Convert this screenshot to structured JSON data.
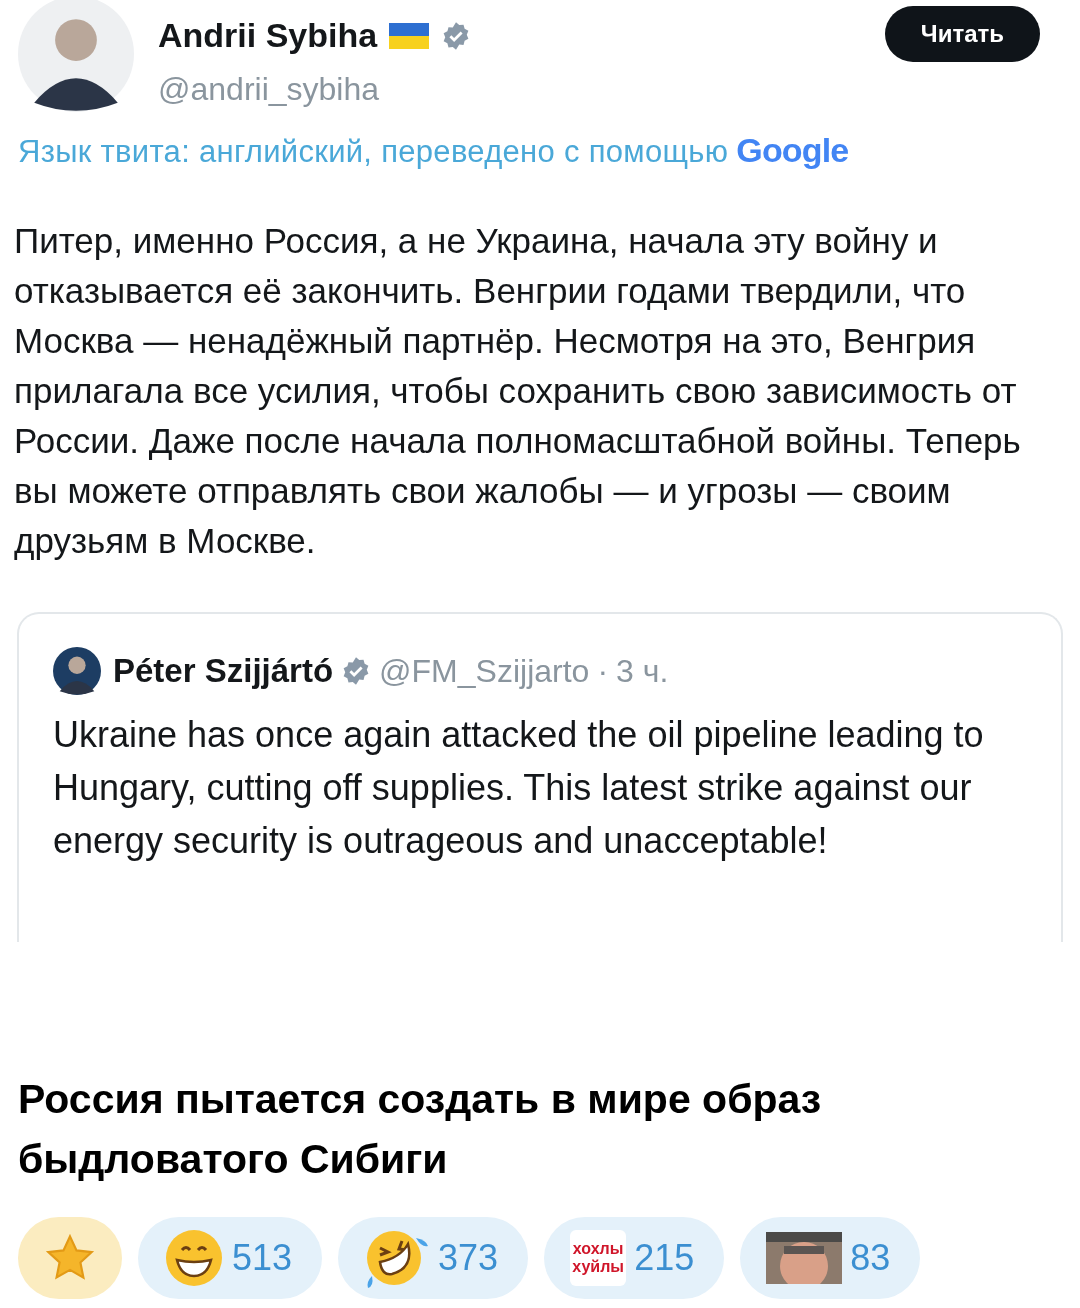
{
  "tweet": {
    "author": {
      "name": "Andrii Sybiha",
      "handle": "@andrii_sybiha",
      "verified": true
    },
    "follow_button": "Читать",
    "translation_note": "Язык твита: английский, переведено с помощью",
    "translator": "Google",
    "text": "Питер, именно Россия, а не Украина, начала эту войну и отказывается её закончить. Венгрии годами твердили, что Москва — ненадёжный партнёр. Несмотря на это, Венгрия прилагала все усилия, чтобы сохранить свою зависимость от России. Даже после начала полномасштабной войны. Теперь вы можете отправлять свои жалобы — и угрозы — своим друзьям в Москве.",
    "quoted": {
      "name": "Péter Szijjártó",
      "verified": true,
      "handle": "@FM_Szijjarto",
      "separator": "·",
      "time": "3 ч.",
      "text": "Ukraine has once again attacked the oil pipeline leading to Hungary, cutting off supplies. This latest strike against our energy security is outrageous and unacceptable!"
    }
  },
  "caption": "Россия пытается создать в мире образ быдловатого Сибиги",
  "reactions": [
    {
      "kind": "star"
    },
    {
      "kind": "grin",
      "count": "513"
    },
    {
      "kind": "rofl",
      "count": "373"
    },
    {
      "kind": "sticker",
      "sticker_text": "хохлы хуйлы",
      "count": "215"
    },
    {
      "kind": "photo",
      "count": "83"
    }
  ]
}
